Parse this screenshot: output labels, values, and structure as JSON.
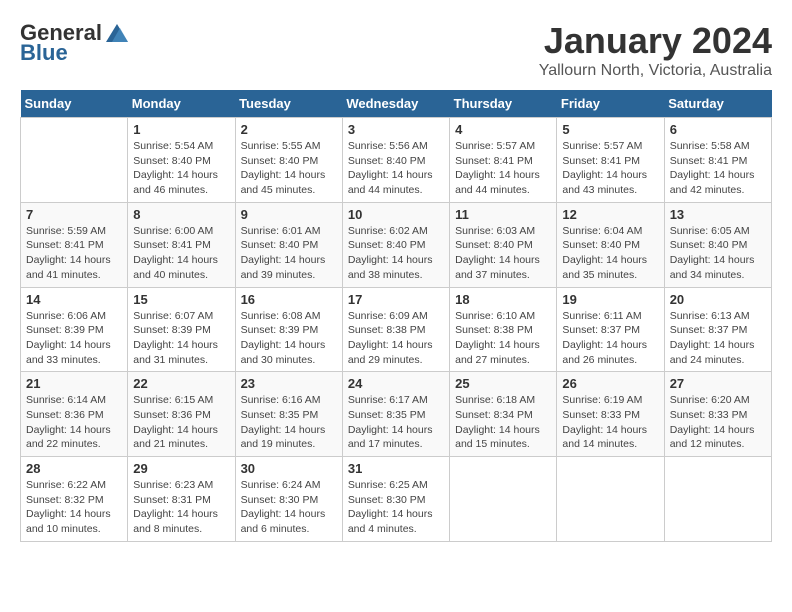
{
  "header": {
    "logo_general": "General",
    "logo_blue": "Blue",
    "title": "January 2024",
    "subtitle": "Yallourn North, Victoria, Australia"
  },
  "days_of_week": [
    "Sunday",
    "Monday",
    "Tuesday",
    "Wednesday",
    "Thursday",
    "Friday",
    "Saturday"
  ],
  "weeks": [
    [
      {
        "day": "",
        "info": ""
      },
      {
        "day": "1",
        "info": "Sunrise: 5:54 AM\nSunset: 8:40 PM\nDaylight: 14 hours\nand 46 minutes."
      },
      {
        "day": "2",
        "info": "Sunrise: 5:55 AM\nSunset: 8:40 PM\nDaylight: 14 hours\nand 45 minutes."
      },
      {
        "day": "3",
        "info": "Sunrise: 5:56 AM\nSunset: 8:40 PM\nDaylight: 14 hours\nand 44 minutes."
      },
      {
        "day": "4",
        "info": "Sunrise: 5:57 AM\nSunset: 8:41 PM\nDaylight: 14 hours\nand 44 minutes."
      },
      {
        "day": "5",
        "info": "Sunrise: 5:57 AM\nSunset: 8:41 PM\nDaylight: 14 hours\nand 43 minutes."
      },
      {
        "day": "6",
        "info": "Sunrise: 5:58 AM\nSunset: 8:41 PM\nDaylight: 14 hours\nand 42 minutes."
      }
    ],
    [
      {
        "day": "7",
        "info": "Sunrise: 5:59 AM\nSunset: 8:41 PM\nDaylight: 14 hours\nand 41 minutes."
      },
      {
        "day": "8",
        "info": "Sunrise: 6:00 AM\nSunset: 8:41 PM\nDaylight: 14 hours\nand 40 minutes."
      },
      {
        "day": "9",
        "info": "Sunrise: 6:01 AM\nSunset: 8:40 PM\nDaylight: 14 hours\nand 39 minutes."
      },
      {
        "day": "10",
        "info": "Sunrise: 6:02 AM\nSunset: 8:40 PM\nDaylight: 14 hours\nand 38 minutes."
      },
      {
        "day": "11",
        "info": "Sunrise: 6:03 AM\nSunset: 8:40 PM\nDaylight: 14 hours\nand 37 minutes."
      },
      {
        "day": "12",
        "info": "Sunrise: 6:04 AM\nSunset: 8:40 PM\nDaylight: 14 hours\nand 35 minutes."
      },
      {
        "day": "13",
        "info": "Sunrise: 6:05 AM\nSunset: 8:40 PM\nDaylight: 14 hours\nand 34 minutes."
      }
    ],
    [
      {
        "day": "14",
        "info": "Sunrise: 6:06 AM\nSunset: 8:39 PM\nDaylight: 14 hours\nand 33 minutes."
      },
      {
        "day": "15",
        "info": "Sunrise: 6:07 AM\nSunset: 8:39 PM\nDaylight: 14 hours\nand 31 minutes."
      },
      {
        "day": "16",
        "info": "Sunrise: 6:08 AM\nSunset: 8:39 PM\nDaylight: 14 hours\nand 30 minutes."
      },
      {
        "day": "17",
        "info": "Sunrise: 6:09 AM\nSunset: 8:38 PM\nDaylight: 14 hours\nand 29 minutes."
      },
      {
        "day": "18",
        "info": "Sunrise: 6:10 AM\nSunset: 8:38 PM\nDaylight: 14 hours\nand 27 minutes."
      },
      {
        "day": "19",
        "info": "Sunrise: 6:11 AM\nSunset: 8:37 PM\nDaylight: 14 hours\nand 26 minutes."
      },
      {
        "day": "20",
        "info": "Sunrise: 6:13 AM\nSunset: 8:37 PM\nDaylight: 14 hours\nand 24 minutes."
      }
    ],
    [
      {
        "day": "21",
        "info": "Sunrise: 6:14 AM\nSunset: 8:36 PM\nDaylight: 14 hours\nand 22 minutes."
      },
      {
        "day": "22",
        "info": "Sunrise: 6:15 AM\nSunset: 8:36 PM\nDaylight: 14 hours\nand 21 minutes."
      },
      {
        "day": "23",
        "info": "Sunrise: 6:16 AM\nSunset: 8:35 PM\nDaylight: 14 hours\nand 19 minutes."
      },
      {
        "day": "24",
        "info": "Sunrise: 6:17 AM\nSunset: 8:35 PM\nDaylight: 14 hours\nand 17 minutes."
      },
      {
        "day": "25",
        "info": "Sunrise: 6:18 AM\nSunset: 8:34 PM\nDaylight: 14 hours\nand 15 minutes."
      },
      {
        "day": "26",
        "info": "Sunrise: 6:19 AM\nSunset: 8:33 PM\nDaylight: 14 hours\nand 14 minutes."
      },
      {
        "day": "27",
        "info": "Sunrise: 6:20 AM\nSunset: 8:33 PM\nDaylight: 14 hours\nand 12 minutes."
      }
    ],
    [
      {
        "day": "28",
        "info": "Sunrise: 6:22 AM\nSunset: 8:32 PM\nDaylight: 14 hours\nand 10 minutes."
      },
      {
        "day": "29",
        "info": "Sunrise: 6:23 AM\nSunset: 8:31 PM\nDaylight: 14 hours\nand 8 minutes."
      },
      {
        "day": "30",
        "info": "Sunrise: 6:24 AM\nSunset: 8:30 PM\nDaylight: 14 hours\nand 6 minutes."
      },
      {
        "day": "31",
        "info": "Sunrise: 6:25 AM\nSunset: 8:30 PM\nDaylight: 14 hours\nand 4 minutes."
      },
      {
        "day": "",
        "info": ""
      },
      {
        "day": "",
        "info": ""
      },
      {
        "day": "",
        "info": ""
      }
    ]
  ]
}
